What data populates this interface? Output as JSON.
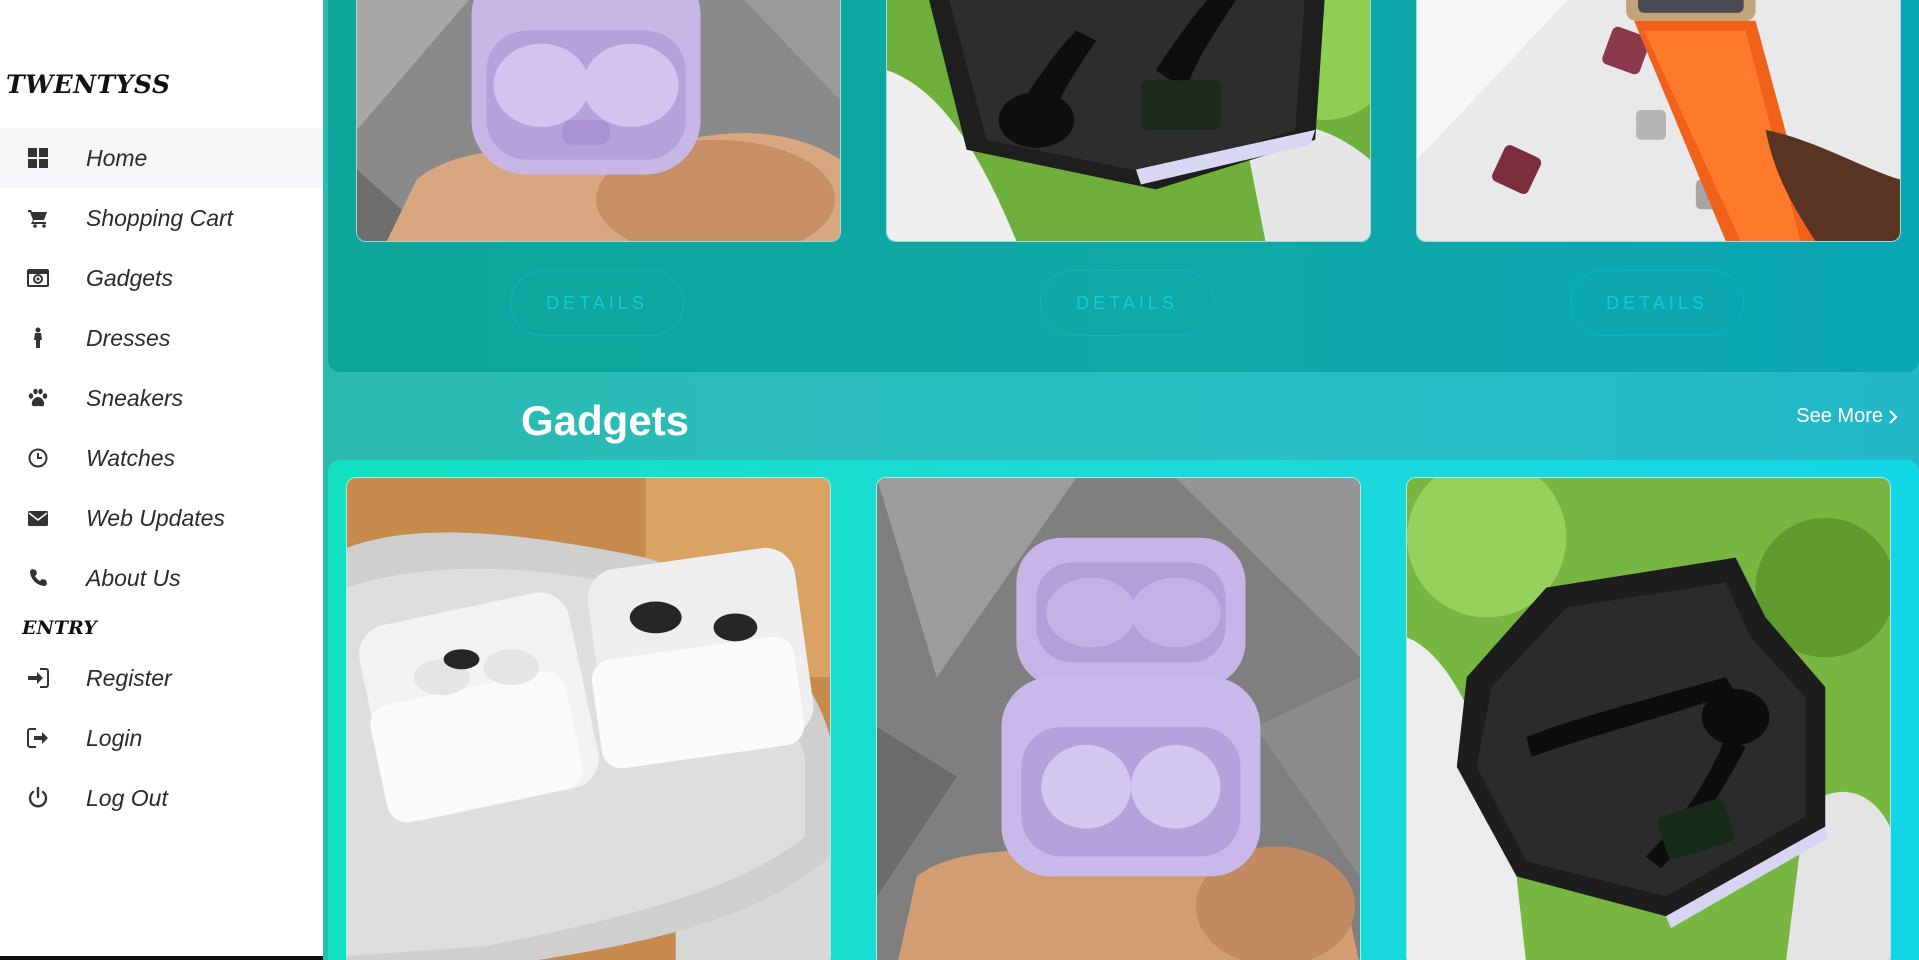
{
  "sidebar": {
    "brand": "TWENTYSS",
    "items": [
      {
        "label": "Home",
        "icon": "dashboard-icon",
        "active": true
      },
      {
        "label": "Shopping Cart",
        "icon": "cart-icon"
      },
      {
        "label": "Gadgets",
        "icon": "camera-icon"
      },
      {
        "label": "Dresses",
        "icon": "person-icon"
      },
      {
        "label": "Sneakers",
        "icon": "paw-icon"
      },
      {
        "label": "Watches",
        "icon": "clock-icon"
      },
      {
        "label": "Web Updates",
        "icon": "envelope-icon"
      },
      {
        "label": "About Us",
        "icon": "phone-icon"
      }
    ],
    "entry_title": "ENTRY",
    "entry_items": [
      {
        "label": "Register",
        "icon": "sign-in-icon"
      },
      {
        "label": "Login",
        "icon": "sign-out-icon"
      },
      {
        "label": "Log Out",
        "icon": "power-icon"
      }
    ]
  },
  "top_section": {
    "details_label": "DETAILS",
    "cards": [
      {
        "product": "purple-earbuds-case-photo"
      },
      {
        "product": "black-gaming-earbuds-photo"
      },
      {
        "product": "orange-strap-smartwatch-photo"
      }
    ]
  },
  "gadgets": {
    "heading": "Gadgets",
    "see_more": "See More",
    "cards": [
      {
        "product": "white-earbuds-cases-photo"
      },
      {
        "product": "purple-earbuds-case-photo"
      },
      {
        "product": "black-gaming-earbuds-photo"
      }
    ]
  },
  "colors": {
    "sidebar_bg": "#ffffff",
    "main_bg": "#27bfc2",
    "details_text": "#14c9da"
  }
}
